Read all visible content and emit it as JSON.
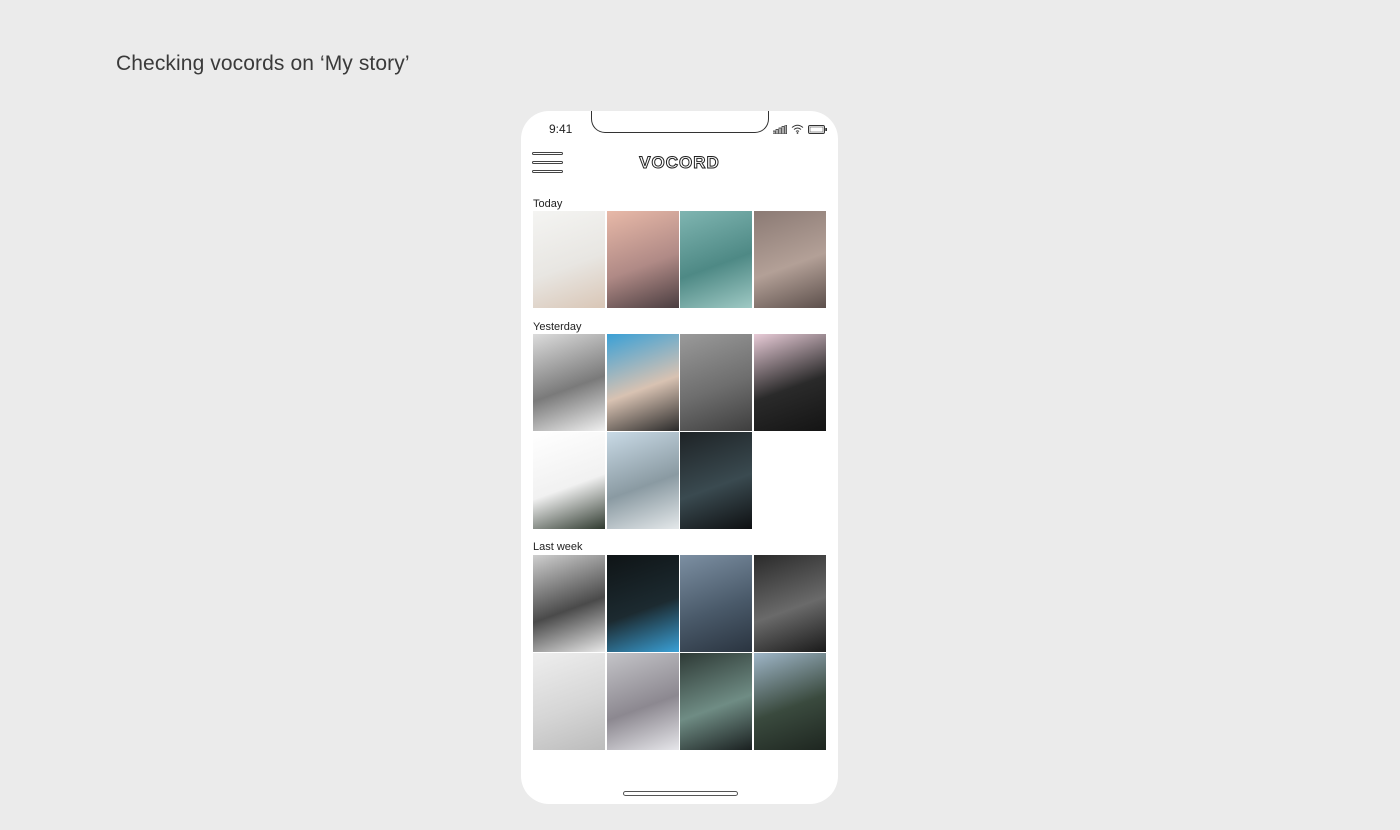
{
  "caption": "Checking vocords on ‘My story’",
  "phone": {
    "status_bar": {
      "time": "9:41",
      "icons": [
        "signal-icon",
        "wifi-icon",
        "battery-icon"
      ]
    },
    "header": {
      "logo": "VOCORD",
      "menu_icon": "hamburger-menu-icon"
    },
    "sections": [
      {
        "label": "Today",
        "photos": [
          {
            "name": "photo-cake",
            "colors": [
              "#f4f4f2",
              "#e8e6e2",
              "#d9c6b6"
            ]
          },
          {
            "name": "photo-beach-sunset",
            "colors": [
              "#e8b9a8",
              "#b08a86",
              "#4a3d40"
            ]
          },
          {
            "name": "photo-glass-roof",
            "colors": [
              "#7fb5b1",
              "#4e8985",
              "#9fc9c4"
            ]
          },
          {
            "name": "photo-aerial-ruins",
            "colors": [
              "#8b7a74",
              "#b3a097",
              "#5c4f4b"
            ]
          }
        ]
      },
      {
        "label": "Yesterday",
        "photos": [
          {
            "name": "photo-gamepad",
            "colors": [
              "#dcdcdc",
              "#7a7a7a",
              "#f0f0f0"
            ]
          },
          {
            "name": "photo-pool-swimmer",
            "colors": [
              "#3aa0d6",
              "#d8c2b2",
              "#2a2a2a"
            ]
          },
          {
            "name": "photo-misty-trees",
            "colors": [
              "#9a9a9a",
              "#6e6e6e",
              "#3e3e3e"
            ]
          },
          {
            "name": "photo-pink-mountain",
            "colors": [
              "#e9ccd8",
              "#2a2a2a",
              "#141414"
            ]
          },
          {
            "name": "photo-palm-beach",
            "colors": [
              "#ffffff",
              "#f1f1f1",
              "#2f3a2f"
            ]
          },
          {
            "name": "photo-city-hills",
            "colors": [
              "#c9dae6",
              "#8a9aa2",
              "#e4e8ea"
            ]
          },
          {
            "name": "photo-dark-space",
            "colors": [
              "#1e2326",
              "#3a4a50",
              "#0e1012"
            ]
          }
        ]
      },
      {
        "label": "Last week",
        "photos": [
          {
            "name": "photo-rooftop-hills",
            "colors": [
              "#cfcfcf",
              "#4a4a4a",
              "#e9e9e9"
            ]
          },
          {
            "name": "photo-hustle-neon",
            "colors": [
              "#0f1416",
              "#1c2a30",
              "#3aa0d6"
            ]
          },
          {
            "name": "photo-blue-haze",
            "colors": [
              "#7c8fa2",
              "#4a5a6a",
              "#2a3440"
            ]
          },
          {
            "name": "photo-city-street",
            "colors": [
              "#2a2a2a",
              "#6a6a6a",
              "#1a1a1a"
            ]
          },
          {
            "name": "photo-white-shirt",
            "colors": [
              "#eeeeee",
              "#d6d6d6",
              "#bcbcbc"
            ]
          },
          {
            "name": "photo-santorini",
            "colors": [
              "#c4c4c8",
              "#8c8890",
              "#e6e6ea"
            ]
          },
          {
            "name": "photo-dark-leaves",
            "colors": [
              "#2e3a36",
              "#6f8c84",
              "#1a2020"
            ]
          },
          {
            "name": "photo-forest-sky",
            "colors": [
              "#9fb6c8",
              "#3a4a3e",
              "#1e2620"
            ]
          }
        ]
      }
    ]
  }
}
